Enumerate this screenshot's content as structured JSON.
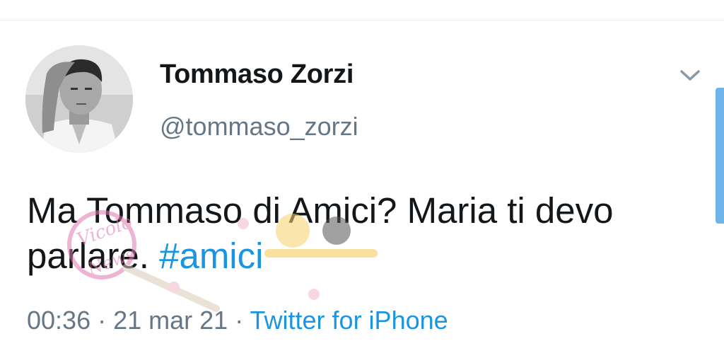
{
  "user": {
    "display_name": "Tommaso Zorzi",
    "handle": "@tommaso_zorzi",
    "avatar": "profile-photo"
  },
  "tweet": {
    "text": "Ma Tommaso di Amici? Maria ti devo parlare. ",
    "hashtag": "#amici"
  },
  "meta": {
    "time": "00:36",
    "separator1": " · ",
    "date": "21 mar 21",
    "separator2": " · ",
    "source": "Twitter for iPhone"
  },
  "icons": {
    "menu": "chevron-down-icon"
  },
  "colors": {
    "link": "#1b95e0",
    "text": "#14171a",
    "secondary": "#657786"
  }
}
